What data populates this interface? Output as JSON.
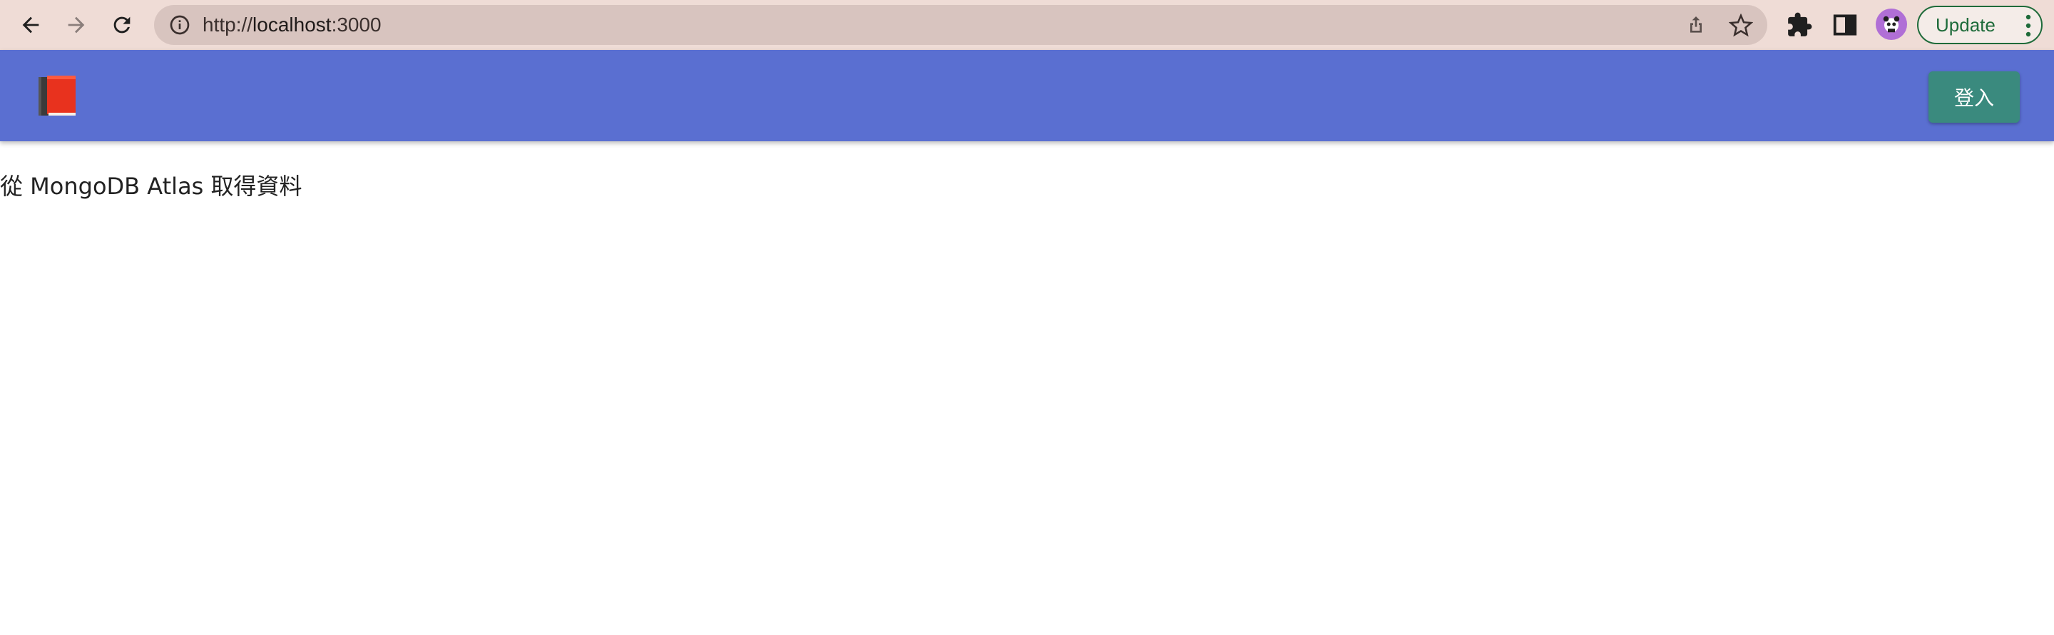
{
  "browser": {
    "url_scheme": "http://",
    "url_host": "localhost",
    "url_port": ":3000",
    "update_label": "Update",
    "icons": [
      "back-arrow-icon",
      "forward-arrow-icon",
      "reload-icon",
      "info-icon",
      "share-icon",
      "star-icon",
      "extensions-icon",
      "side-panel-icon",
      "avatar",
      "more-vert-icon"
    ]
  },
  "appbar": {
    "logo": "book-icon",
    "login_label": "登入",
    "background": "#5a6fd1",
    "button_color": "#3a8a7e"
  },
  "main": {
    "text": "從 MongoDB Atlas 取得資料"
  }
}
